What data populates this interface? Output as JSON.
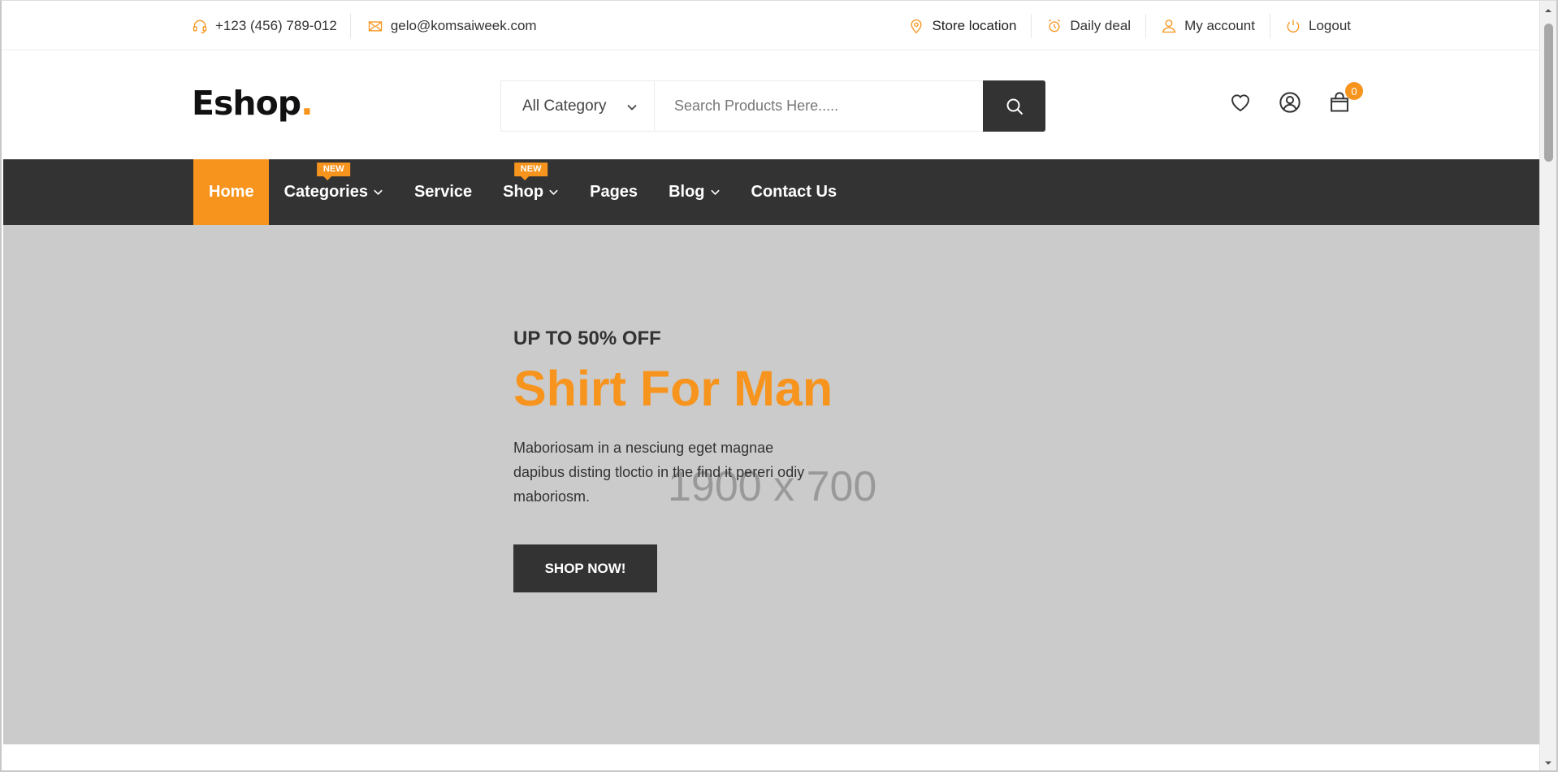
{
  "topbar": {
    "phone": "+123 (456) 789-012",
    "email": "gelo@komsaiweek.com",
    "links": [
      {
        "label": "Store location",
        "icon": "map-pin-icon"
      },
      {
        "label": "Daily deal",
        "icon": "alarm-clock-icon"
      },
      {
        "label": "My account",
        "icon": "user-icon"
      },
      {
        "label": "Logout",
        "icon": "power-icon"
      }
    ]
  },
  "header": {
    "logo_text": "Eshop",
    "logo_dot": ".",
    "category_selected": "All Category",
    "search_placeholder": "Search Products Here.....",
    "cart_count": "0"
  },
  "nav": {
    "items": [
      {
        "label": "Home",
        "active": true
      },
      {
        "label": "Categories",
        "badge": "NEW",
        "dropdown": true
      },
      {
        "label": "Service"
      },
      {
        "label": "Shop",
        "badge": "NEW",
        "dropdown": true
      },
      {
        "label": "Pages"
      },
      {
        "label": "Blog",
        "dropdown": true
      },
      {
        "label": "Contact Us"
      }
    ]
  },
  "hero": {
    "placeholder": "1900 x 700",
    "subtitle": "UP TO 50% OFF",
    "title": "Shirt For Man",
    "description": "Maboriosam in a nesciung eget magnae dapibus disting tloctio in the find it pereri odiy maboriosm.",
    "button": "SHOP NOW!"
  },
  "colors": {
    "accent": "#f7941d",
    "dark": "#333333",
    "hero_bg": "#cbcbcb"
  }
}
